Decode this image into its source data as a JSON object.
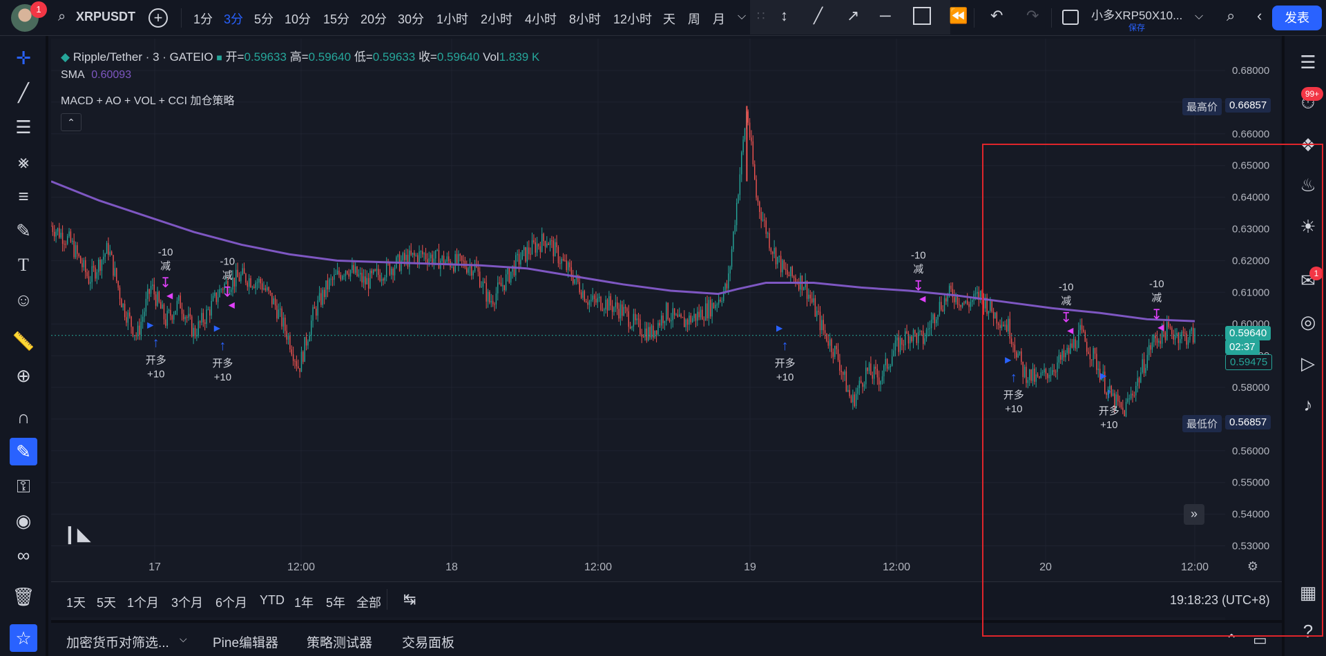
{
  "topbar": {
    "avatar_badge": "1",
    "symbol": "XRPUSDT",
    "intervals": [
      "1分",
      "3分",
      "5分",
      "10分",
      "15分",
      "20分",
      "30分",
      "1小时",
      "2小时",
      "4小时",
      "8小时",
      "12小时",
      "天",
      "周",
      "月"
    ],
    "active_interval": "3分",
    "layout_name": "小多XRP50X10...",
    "save_label": "保存",
    "publish_label": "发表"
  },
  "legend": {
    "title": "Ripple/Tether · 3 · GATEIO",
    "open_label": "开=",
    "open": "0.59633",
    "high_label": "高=",
    "high": "0.59640",
    "low_label": "低=",
    "low": "0.59633",
    "close_label": "收=",
    "close": "0.59640",
    "vol_label": "Vol",
    "vol": "1.839 K",
    "sma_label": "SMA",
    "sma_value": "0.60093",
    "strategy_label": "MACD + AO + VOL + CCI 加仓策略"
  },
  "price_axis": {
    "ticks": [
      "0.68000",
      "0.67000",
      "0.66000",
      "0.65000",
      "0.64000",
      "0.63000",
      "0.62000",
      "0.61000",
      "0.60000",
      "0.59000",
      "0.58000",
      "0.57000",
      "0.56000",
      "0.55000",
      "0.54000",
      "0.53000"
    ],
    "high_label": "最高价",
    "high_value": "0.66857",
    "low_label": "最低价",
    "low_value": "0.56857",
    "current_price": "0.59640",
    "countdown": "02:37",
    "secondary_price": "0.59475"
  },
  "time_axis": {
    "ticks": [
      "17",
      "12:00",
      "18",
      "12:00",
      "19",
      "12:00",
      "20",
      "12:00"
    ]
  },
  "trades": [
    {
      "kind": "long",
      "label": "开多",
      "qty": "+10"
    },
    {
      "kind": "reduce",
      "label": "减",
      "qty": "-10"
    },
    {
      "kind": "reduce",
      "label": "减",
      "qty": "-10"
    },
    {
      "kind": "long",
      "label": "开多",
      "qty": "+10"
    },
    {
      "kind": "long",
      "label": "开多",
      "qty": "+10"
    },
    {
      "kind": "reduce",
      "label": "减",
      "qty": "-10"
    },
    {
      "kind": "long",
      "label": "开多",
      "qty": "+10"
    },
    {
      "kind": "reduce",
      "label": "减",
      "qty": "-10"
    },
    {
      "kind": "long",
      "label": "开多",
      "qty": "+10"
    },
    {
      "kind": "reduce",
      "label": "减",
      "qty": "-10"
    }
  ],
  "bottombar": {
    "ranges": [
      "1天",
      "5天",
      "1个月",
      "3个月",
      "6个月",
      "YTD",
      "1年",
      "5年",
      "全部"
    ],
    "clock": "19:18:23 (UTC+8)"
  },
  "bottompanel": {
    "tabs": [
      "加密货币对筛选...",
      "Pine编辑器",
      "策略测试器",
      "交易面板"
    ]
  },
  "rightbar": {
    "badge_top": "99+",
    "badge_chat": "1"
  },
  "colors": {
    "up": "#26a69a",
    "down": "#ef5350",
    "sma": "#7e57c2",
    "accent": "#2962ff",
    "reduce": "#e040fb",
    "highlight": "#e0252b"
  },
  "chart_data": {
    "type": "candlestick",
    "symbol": "Ripple/Tether",
    "interval": "3",
    "exchange": "GATEIO",
    "x": [
      "17",
      "12:00",
      "18",
      "12:00",
      "19",
      "12:00",
      "20",
      "12:00"
    ],
    "ylim": [
      0.525,
      0.685
    ],
    "close_path": [
      [
        0.0,
        0.631
      ],
      [
        0.02,
        0.626
      ],
      [
        0.04,
        0.614
      ],
      [
        0.06,
        0.624
      ],
      [
        0.075,
        0.606
      ],
      [
        0.09,
        0.596
      ],
      [
        0.105,
        0.612
      ],
      [
        0.12,
        0.601
      ],
      [
        0.135,
        0.607
      ],
      [
        0.15,
        0.597
      ],
      [
        0.165,
        0.604
      ],
      [
        0.18,
        0.612
      ],
      [
        0.2,
        0.615
      ],
      [
        0.22,
        0.613
      ],
      [
        0.235,
        0.606
      ],
      [
        0.25,
        0.595
      ],
      [
        0.26,
        0.586
      ],
      [
        0.275,
        0.603
      ],
      [
        0.29,
        0.612
      ],
      [
        0.31,
        0.618
      ],
      [
        0.33,
        0.613
      ],
      [
        0.35,
        0.617
      ],
      [
        0.37,
        0.62
      ],
      [
        0.39,
        0.622
      ],
      [
        0.41,
        0.62
      ],
      [
        0.43,
        0.619
      ],
      [
        0.445,
        0.618
      ],
      [
        0.46,
        0.607
      ],
      [
        0.475,
        0.613
      ],
      [
        0.49,
        0.62
      ],
      [
        0.505,
        0.624
      ],
      [
        0.52,
        0.627
      ],
      [
        0.535,
        0.62
      ],
      [
        0.55,
        0.614
      ],
      [
        0.565,
        0.607
      ],
      [
        0.58,
        0.607
      ],
      [
        0.6,
        0.604
      ],
      [
        0.615,
        0.599
      ],
      [
        0.63,
        0.597
      ],
      [
        0.645,
        0.604
      ],
      [
        0.66,
        0.6
      ],
      [
        0.68,
        0.603
      ],
      [
        0.695,
        0.606
      ],
      [
        0.71,
        0.612
      ],
      [
        0.72,
        0.64
      ],
      [
        0.73,
        0.668
      ],
      [
        0.74,
        0.64
      ],
      [
        0.755,
        0.625
      ],
      [
        0.77,
        0.616
      ],
      [
        0.79,
        0.613
      ],
      [
        0.81,
        0.598
      ],
      [
        0.825,
        0.59
      ],
      [
        0.84,
        0.575
      ],
      [
        0.855,
        0.585
      ],
      [
        0.87,
        0.583
      ],
      [
        0.885,
        0.592
      ],
      [
        0.9,
        0.597
      ],
      [
        0.915,
        0.595
      ],
      [
        0.93,
        0.605
      ],
      [
        0.945,
        0.61
      ],
      [
        0.96,
        0.606
      ],
      [
        0.975,
        0.609
      ],
      [
        0.99,
        0.603
      ],
      [
        1.005,
        0.599
      ],
      [
        1.02,
        0.585
      ],
      [
        1.035,
        0.582
      ],
      [
        1.05,
        0.586
      ],
      [
        1.065,
        0.59
      ],
      [
        1.08,
        0.597
      ],
      [
        1.095,
        0.589
      ],
      [
        1.11,
        0.578
      ],
      [
        1.125,
        0.572
      ],
      [
        1.14,
        0.582
      ],
      [
        1.155,
        0.594
      ],
      [
        1.17,
        0.598
      ],
      [
        1.19,
        0.596
      ],
      [
        1.2,
        0.5964
      ]
    ],
    "sma_path": [
      [
        0.0,
        0.645
      ],
      [
        0.05,
        0.639
      ],
      [
        0.1,
        0.634
      ],
      [
        0.15,
        0.629
      ],
      [
        0.2,
        0.625
      ],
      [
        0.25,
        0.622
      ],
      [
        0.3,
        0.62
      ],
      [
        0.35,
        0.6195
      ],
      [
        0.4,
        0.619
      ],
      [
        0.45,
        0.6185
      ],
      [
        0.5,
        0.6175
      ],
      [
        0.55,
        0.615
      ],
      [
        0.6,
        0.6125
      ],
      [
        0.65,
        0.6105
      ],
      [
        0.7,
        0.6095
      ],
      [
        0.72,
        0.611
      ],
      [
        0.75,
        0.613
      ],
      [
        0.8,
        0.613
      ],
      [
        0.85,
        0.6115
      ],
      [
        0.9,
        0.6105
      ],
      [
        0.95,
        0.609
      ],
      [
        1.0,
        0.607
      ],
      [
        1.05,
        0.605
      ],
      [
        1.1,
        0.6035
      ],
      [
        1.15,
        0.6015
      ],
      [
        1.2,
        0.6009
      ]
    ],
    "high": 0.66857,
    "low": 0.56857,
    "last": 0.5964,
    "sma": 0.60093
  }
}
